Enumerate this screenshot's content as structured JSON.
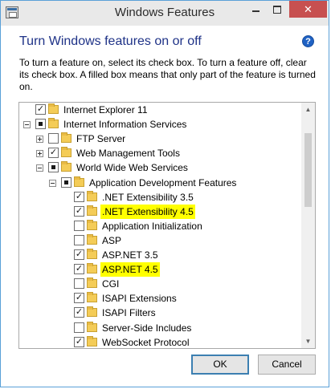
{
  "window": {
    "title": "Windows Features",
    "minimize_label": "",
    "maximize_label": "",
    "close_label": "✕"
  },
  "heading": "Turn Windows features on or off",
  "help_symbol": "?",
  "description": "To turn a feature on, select its check box. To turn a feature off, clear its check box. A filled box means that only part of the feature is turned on.",
  "tree": [
    {
      "label": "Internet Explorer 11",
      "level": 0,
      "expander": "none",
      "state": "checked",
      "highlight": false
    },
    {
      "label": "Internet Information Services",
      "level": 0,
      "expander": "expanded",
      "state": "partial",
      "highlight": false
    },
    {
      "label": "FTP Server",
      "level": 1,
      "expander": "collapsed",
      "state": "unchecked",
      "highlight": false
    },
    {
      "label": "Web Management Tools",
      "level": 1,
      "expander": "collapsed",
      "state": "checked",
      "highlight": false
    },
    {
      "label": "World Wide Web Services",
      "level": 1,
      "expander": "expanded",
      "state": "partial",
      "highlight": false
    },
    {
      "label": "Application Development Features",
      "level": 2,
      "expander": "expanded",
      "state": "partial",
      "highlight": false
    },
    {
      "label": ".NET Extensibility 3.5",
      "level": 3,
      "expander": "none",
      "state": "checked",
      "highlight": false
    },
    {
      "label": ".NET Extensibility 4.5",
      "level": 3,
      "expander": "none",
      "state": "checked",
      "highlight": true
    },
    {
      "label": "Application Initialization",
      "level": 3,
      "expander": "none",
      "state": "unchecked",
      "highlight": false
    },
    {
      "label": "ASP",
      "level": 3,
      "expander": "none",
      "state": "unchecked",
      "highlight": false
    },
    {
      "label": "ASP.NET 3.5",
      "level": 3,
      "expander": "none",
      "state": "checked",
      "highlight": false
    },
    {
      "label": "ASP.NET 4.5",
      "level": 3,
      "expander": "none",
      "state": "checked",
      "highlight": true
    },
    {
      "label": "CGI",
      "level": 3,
      "expander": "none",
      "state": "unchecked",
      "highlight": false
    },
    {
      "label": "ISAPI Extensions",
      "level": 3,
      "expander": "none",
      "state": "checked",
      "highlight": false
    },
    {
      "label": "ISAPI Filters",
      "level": 3,
      "expander": "none",
      "state": "checked",
      "highlight": false
    },
    {
      "label": "Server-Side Includes",
      "level": 3,
      "expander": "none",
      "state": "unchecked",
      "highlight": false
    },
    {
      "label": "WebSocket Protocol",
      "level": 3,
      "expander": "none",
      "state": "checked",
      "highlight": false
    }
  ],
  "scrollbar": {
    "up_symbol": "▲",
    "down_symbol": "▼"
  },
  "buttons": {
    "ok": "OK",
    "cancel": "Cancel"
  }
}
